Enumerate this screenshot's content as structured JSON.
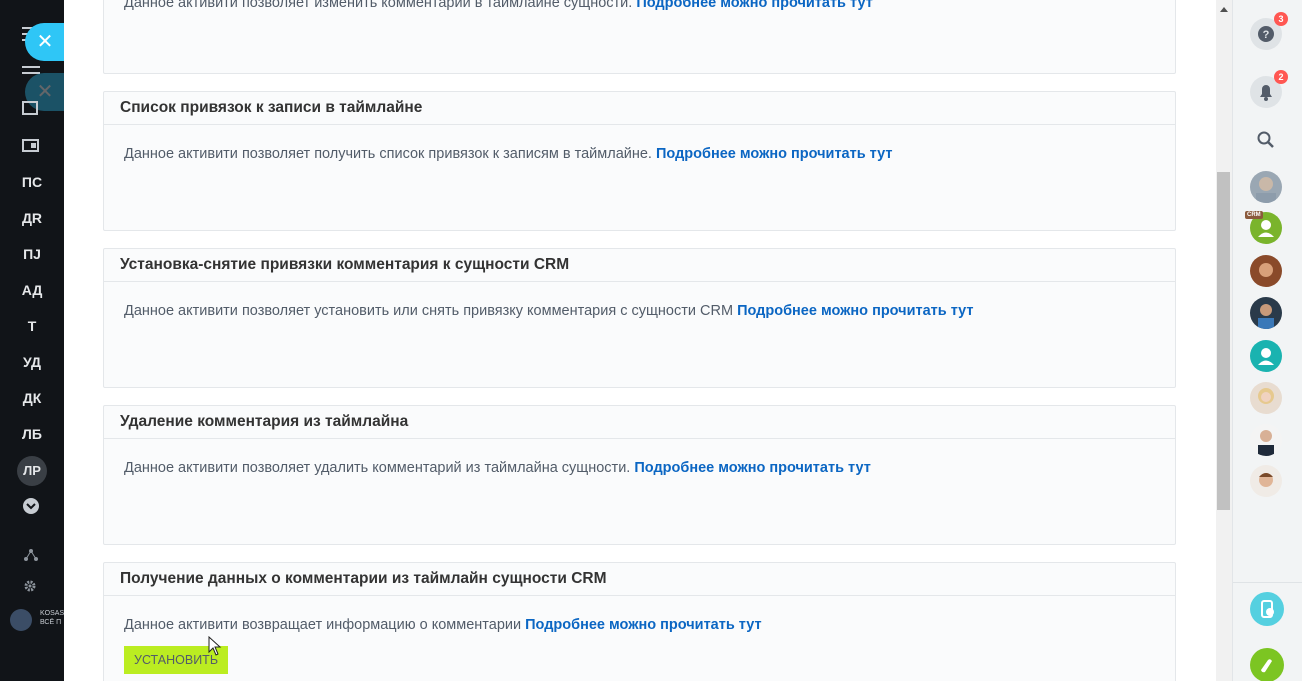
{
  "left_sidebar": {
    "close_label": "✕",
    "nav_items": [
      "ПС",
      "ДR",
      "ПJ",
      "АД",
      "Т",
      "УД",
      "ДК",
      "ЛБ"
    ],
    "avatar_abbr": "ЛР",
    "brand_text": "KOSAS\nВСЁ П"
  },
  "cards": [
    {
      "title": "",
      "text": "Данное активити позволяет изменить комментарии в таймлайне сущности.",
      "link": "Подробнее можно прочитать тут"
    },
    {
      "title": "Список привязок к записи в таймлайне",
      "text": "Данное активити позволяет получить список привязок к записям в таймлайне.",
      "link": "Подробнее можно прочитать тут"
    },
    {
      "title": "Установка-снятие привязки комментария к сущности CRM",
      "text": "Данное активити позволяет установить или снять привязку комментария с сущности CRM",
      "link": "Подробнее можно прочитать тут"
    },
    {
      "title": "Удаление комментария из таймлайна",
      "text": "Данное активити позволяет удалить комментарий из таймлайна сущности.",
      "link": "Подробнее можно прочитать тут"
    },
    {
      "title": "Получение данных о комментарии из таймлайн сущности CRM",
      "text": "Данное активити возвращает информацию о комментарии",
      "link": "Подробнее можно прочитать тут",
      "button": "УСТАНОВИТЬ"
    }
  ],
  "right_bar": {
    "help_badge": "3",
    "notifications_badge": "2",
    "crm_tag": "CRM"
  },
  "colors": {
    "accent_link": "#0b66c3",
    "install_button": "#bbed21",
    "sidebar_bg": "#111418",
    "close_pill": "#2fc6f6",
    "badge": "#ff5752"
  }
}
